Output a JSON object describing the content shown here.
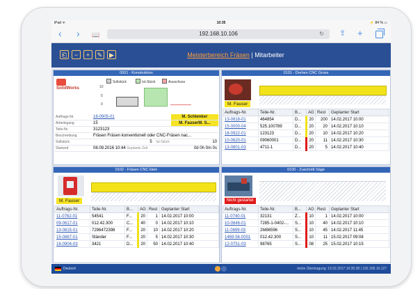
{
  "device": {
    "status_left": "iPad ᯤ",
    "status_time": "10:35",
    "status_right": "⚡ 84 % ▭"
  },
  "browser": {
    "url": "192.168.10.106",
    "back": "‹",
    "forward": "›",
    "book": "📖",
    "reload": "↻",
    "share": "⇪",
    "new_tab": "+"
  },
  "toolbar": {
    "buttons": [
      "⎗",
      "−",
      "+",
      "✎",
      "▶"
    ]
  },
  "app": {
    "title_link": "Meisterbereich Fräsen",
    "title_sep": " | ",
    "title_rest": "Mitarbeiter"
  },
  "panels": {
    "konstruktion": {
      "header": "0001 - Konstruktion",
      "logo_text": "SolidWorks",
      "legend": [
        "Sollstück",
        "Ist-Stück",
        "Ausschuss"
      ],
      "yticks": [
        "10",
        "5",
        "0"
      ],
      "chart_values": {
        "soll": 5,
        "ist": 10,
        "ausschuss": 0
      },
      "auftrag_label": "Auftrags-Nr.",
      "auftrag_value": "16-0905-01",
      "person1": "M. Schlenker",
      "arbeitsgang_label": "Arbeitsgang",
      "arbeitsgang_value": "15",
      "person2": "M. FauserM. S...",
      "teil_label": "Teile-Nr.",
      "teil_value": "3123123",
      "beschr_label": "Beschreibung",
      "beschr_value": "Fräsen Fräsen konventionell oder CNC-Fräsen nac...",
      "soll_label": "Sollstück",
      "soll_value": "5",
      "ist_label": "Ist-Stück",
      "ist_value": "10",
      "start_label": "Startzeit",
      "start_value": "08.09.2016 10:44",
      "gzeit_label": "Geplante Zeit",
      "gzeit_value": "0d 0h 0m 0s"
    },
    "drehen": {
      "header": "0101 - Drehen CNC Gross",
      "operator": "M. Fauser",
      "columns": [
        "Auftrags-Nr.",
        "Teile-Nr.",
        "B...",
        "AG",
        "Rest",
        "Geplanter Start"
      ],
      "rows": [
        [
          "13-0818-01",
          "464854",
          "D...",
          "20",
          "200",
          "14.02.2017 10:00"
        ],
        [
          "15-0000-04",
          "525.100789",
          "D...",
          "20",
          "20",
          "14.02.2017 10:10"
        ],
        [
          "16-0922-01",
          "123123",
          "D...",
          "20",
          "10",
          "14.02.2017 10:20"
        ],
        [
          "10-0620-01",
          "09060001",
          "D...",
          "20",
          "11",
          "14.02.2017 10:30"
        ],
        [
          "13-0801-03",
          "4711-1",
          "D...",
          "20",
          "5",
          "14.02.2017 10:40"
        ]
      ],
      "markers": [
        "#f2e21a",
        "#f2e21a",
        "#f2e21a",
        "#e01a1a",
        "#e01a1a"
      ]
    },
    "fraesen": {
      "header": "0102 - Fräsen CNC klein",
      "operator": "M. Fauser",
      "columns": [
        "Auftrags-Nr.",
        "Teile-Nr.",
        "B...",
        "AG",
        "Rest",
        "Geplanter Start"
      ],
      "rows": [
        [
          "11-0762-01",
          "54541",
          "F...",
          "20",
          "1",
          "14.02.2017 10:00"
        ],
        [
          "09-0617-01",
          "012.42.300",
          "C...",
          "40",
          "0",
          "14.02.2017 10:10"
        ],
        [
          "13-0815-01",
          "7296472398",
          "F...",
          "20",
          "10",
          "14.02.2017 10:20"
        ],
        [
          "15-0867-01",
          "Ständer",
          "F...",
          "20",
          "5",
          "14.02.2017 10:30"
        ],
        [
          "16-0904-03",
          "3421",
          "D...",
          "20",
          "50",
          "14.02.2017 10:40"
        ]
      ],
      "markers": [
        "#f2e21a",
        "#f2e21a",
        "#f2e21a",
        "#f2e21a",
        "#f2e21a"
      ]
    },
    "saege": {
      "header": "0100 - Zuschnitt Säge",
      "status": "Nicht gestartet",
      "columns": [
        "Auftrags-Nr.",
        "Teile-Nr.",
        "B...",
        "AG",
        "Rest",
        "Geplanter Start"
      ],
      "rows": [
        [
          "11-0740-01",
          "32131",
          "Z...",
          "10",
          "1",
          "14.02.2017 10:00"
        ],
        [
          "10-0646-01",
          "7285-1-0402-...",
          "S...",
          "10",
          "40",
          "14.02.2017 10:10"
        ],
        [
          "11-0699-03",
          "2M86596",
          "S...",
          "10",
          "45",
          "14.02.2017 11:45"
        ],
        [
          "1469-56-0001",
          "012.42.300",
          "S...",
          "10",
          "11",
          "15.02.2017 09:08"
        ],
        [
          "12-0751-03",
          "98765",
          "S...",
          "08",
          "25",
          "15.02.2017 10:15"
        ]
      ],
      "markers": [
        "#e01a1a",
        "#e01a1a",
        "#e01a1a",
        "#e01a1a",
        "#e01a1a"
      ]
    }
  },
  "footer": {
    "language": "Deutsch",
    "info": "letzte Übertragung: 15.02.2017 10:35:38 | 192.168.10.127"
  }
}
